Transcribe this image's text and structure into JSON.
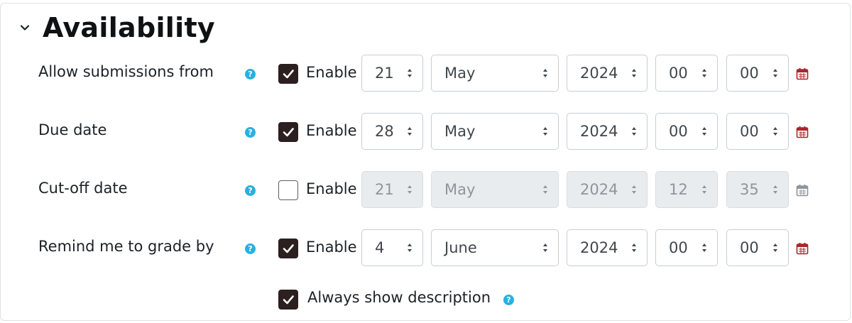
{
  "section": {
    "title": "Availability"
  },
  "rows": [
    {
      "label": "Allow submissions from",
      "enabled": true,
      "enable_label": "Enable",
      "day": "21",
      "month": "May",
      "year": "2024",
      "hour": "00",
      "minute": "00"
    },
    {
      "label": "Due date",
      "enabled": true,
      "enable_label": "Enable",
      "day": "28",
      "month": "May",
      "year": "2024",
      "hour": "00",
      "minute": "00"
    },
    {
      "label": "Cut-off date",
      "enabled": false,
      "enable_label": "Enable",
      "day": "21",
      "month": "May",
      "year": "2024",
      "hour": "12",
      "minute": "35"
    },
    {
      "label": "Remind me to grade by",
      "enabled": true,
      "enable_label": "Enable",
      "day": "4",
      "month": "June",
      "year": "2024",
      "hour": "00",
      "minute": "00"
    }
  ],
  "always_show": {
    "label": "Always show description",
    "checked": true
  },
  "colors": {
    "checkbox_checked": "#2b1f20",
    "help_icon": "#2ab0e0",
    "calendar_active": "#b0232a",
    "calendar_disabled": "#8f959a"
  }
}
